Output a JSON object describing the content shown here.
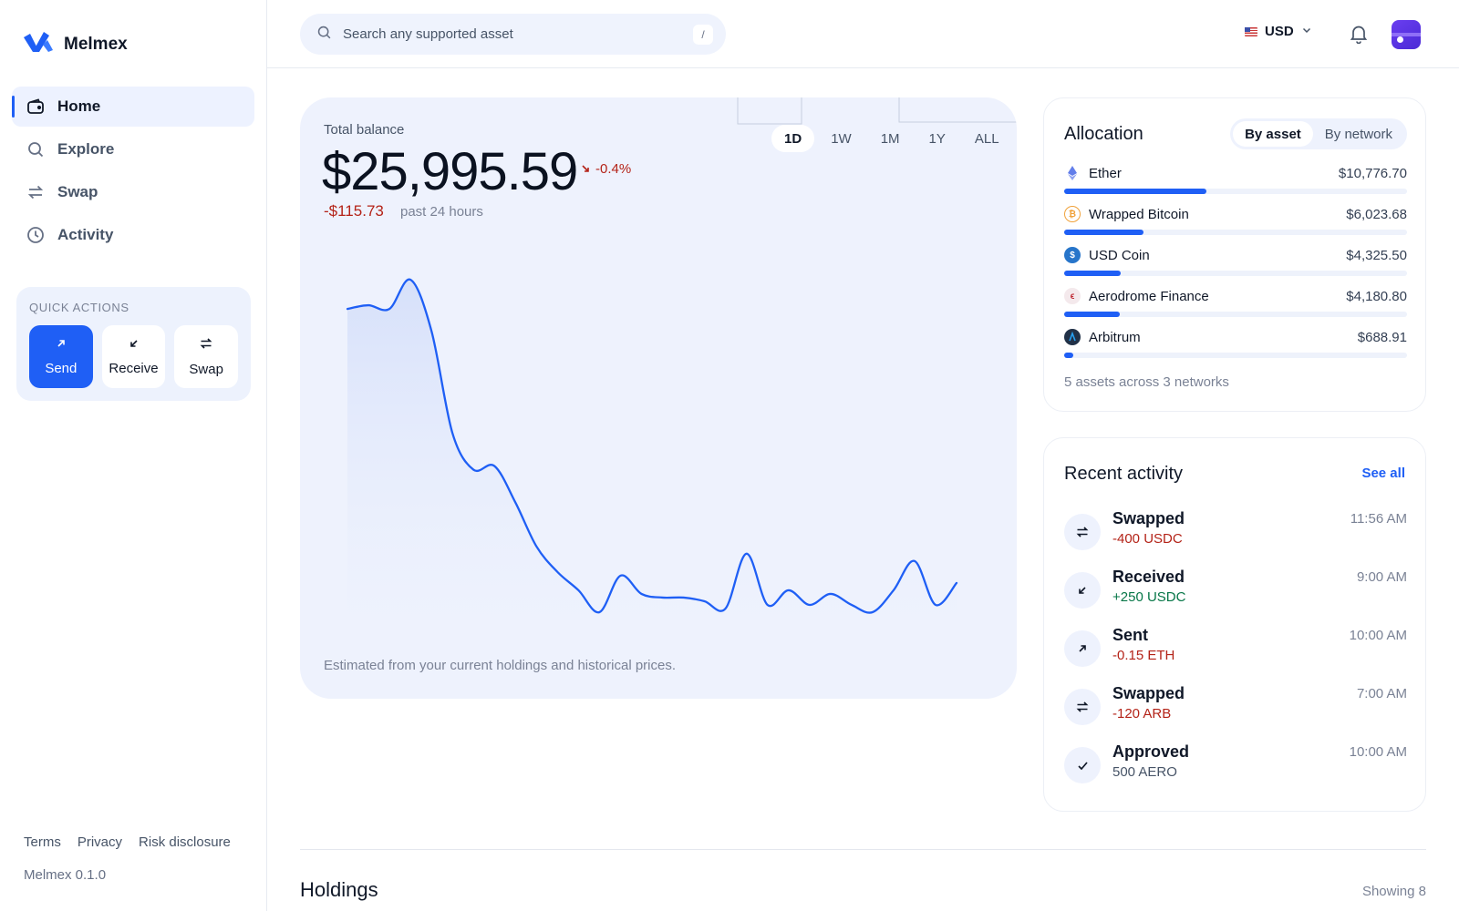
{
  "app": {
    "name": "Melmex",
    "version": "Melmex 0.1.0",
    "accent": "#1f5ff5"
  },
  "nav": [
    {
      "label": "Home",
      "icon": "wallet-icon",
      "active": true
    },
    {
      "label": "Explore",
      "icon": "search-icon"
    },
    {
      "label": "Swap",
      "icon": "swap-icon"
    },
    {
      "label": "Activity",
      "icon": "clock-icon"
    }
  ],
  "quick_actions": {
    "title": "QUICK ACTIONS",
    "items": [
      {
        "label": "Send",
        "icon": "arrow-up-right-icon"
      },
      {
        "label": "Receive",
        "icon": "arrow-down-left-icon"
      },
      {
        "label": "Swap",
        "icon": "swap-icon"
      }
    ]
  },
  "footer": {
    "links": [
      "Terms",
      "Privacy",
      "Risk disclosure"
    ]
  },
  "topbar": {
    "search_placeholder": "Search any supported asset",
    "search_shortcut": "/",
    "currency": "USD"
  },
  "balance": {
    "label": "Total balance",
    "amount": "$25,995.59",
    "change_pct": "-0.4%",
    "change_abs": "-$115.73",
    "period": "past 24 hours",
    "ranges": [
      "1D",
      "1W",
      "1M",
      "1Y",
      "ALL"
    ],
    "active_range": "1D",
    "note": "Estimated from your current holdings and historical prices."
  },
  "chart_data": {
    "type": "area",
    "x": [
      0,
      1,
      2,
      3,
      4,
      5,
      6,
      7,
      8,
      9,
      10,
      11,
      12,
      13,
      14,
      15,
      16,
      17,
      18,
      19,
      20,
      21,
      22,
      23,
      24,
      25,
      26,
      27,
      28,
      29
    ],
    "y": [
      80,
      81,
      80,
      88,
      74,
      46,
      36,
      37,
      27,
      15,
      8,
      3,
      -3,
      7,
      2,
      1,
      1,
      0,
      -2,
      13,
      -1,
      3,
      -1,
      2,
      -1,
      -3,
      3,
      11,
      -1,
      5
    ],
    "color": "#1f5ff5",
    "fill": "#d9e3fb"
  },
  "allocation": {
    "title": "Allocation",
    "tabs": [
      "By asset",
      "By network"
    ],
    "active_tab": "By asset",
    "assets": [
      {
        "name": "Ether",
        "value": "$10,776.70",
        "share": 0.415,
        "icon": "ether-icon"
      },
      {
        "name": "Wrapped Bitcoin",
        "value": "$6,023.68",
        "share": 0.232,
        "icon": "bitcoin-icon"
      },
      {
        "name": "USD Coin",
        "value": "$4,325.50",
        "share": 0.166,
        "icon": "usdc-icon"
      },
      {
        "name": "Aerodrome Finance",
        "value": "$4,180.80",
        "share": 0.161,
        "icon": "aerodrome-icon"
      },
      {
        "name": "Arbitrum",
        "value": "$688.91",
        "share": 0.027,
        "icon": "arbitrum-icon"
      }
    ],
    "summary": "5 assets across 3 networks"
  },
  "activity": {
    "title": "Recent activity",
    "see_all": "See all",
    "items": [
      {
        "title": "Swapped",
        "amount": "-400 USDC",
        "time": "11:56 AM",
        "kind": "neg",
        "icon": "swap-icon"
      },
      {
        "title": "Received",
        "amount": "+250 USDC",
        "time": "9:00 AM",
        "kind": "pos",
        "icon": "arrow-down-left-icon"
      },
      {
        "title": "Sent",
        "amount": "-0.15 ETH",
        "time": "10:00 AM",
        "kind": "neg",
        "icon": "arrow-up-right-icon"
      },
      {
        "title": "Swapped",
        "amount": "-120 ARB",
        "time": "7:00 AM",
        "kind": "neg",
        "icon": "swap-icon"
      },
      {
        "title": "Approved",
        "amount": "500 AERO",
        "time": "10:00 AM",
        "kind": "neu",
        "icon": "check-icon"
      }
    ]
  },
  "holdings": {
    "title": "Holdings",
    "count": "Showing 8"
  }
}
